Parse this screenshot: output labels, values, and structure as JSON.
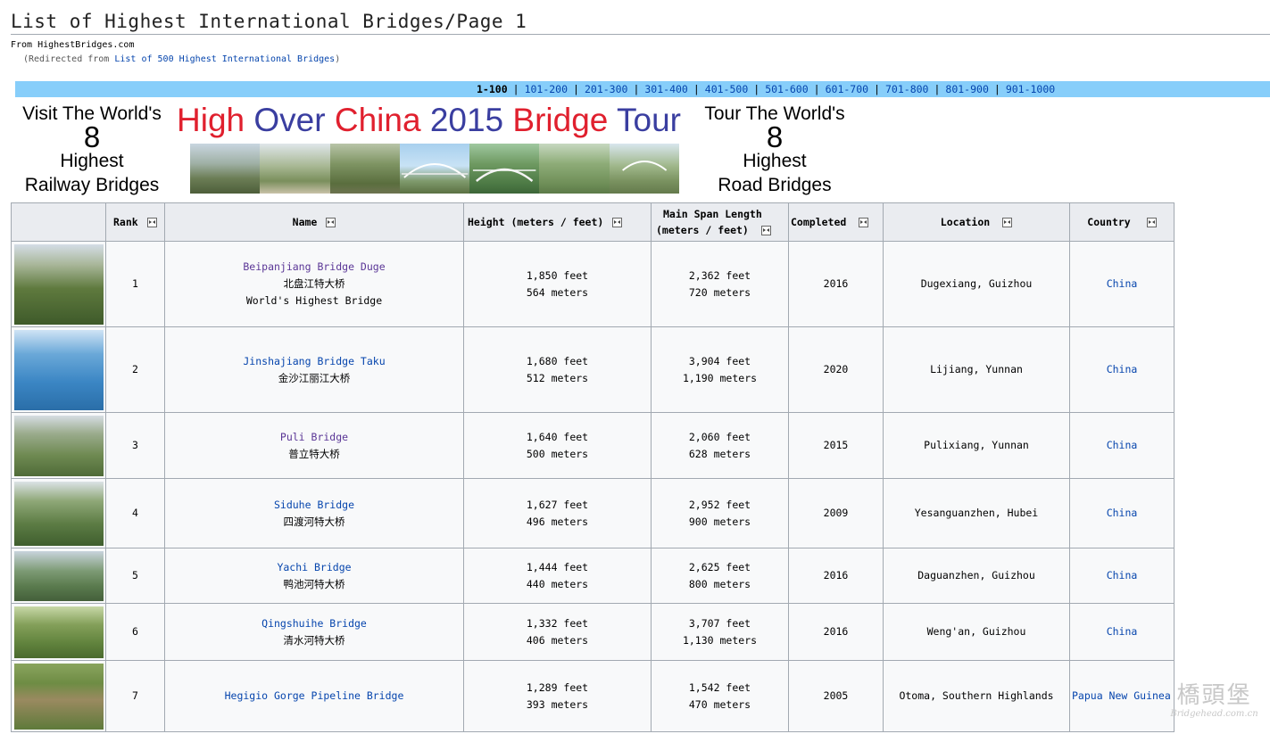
{
  "page": {
    "title": "List of Highest International Bridges/Page 1",
    "site_sub": "From HighestBridges.com",
    "redirect_prefix": "(Redirected from ",
    "redirect_link": "List of 500 Highest International Bridges",
    "redirect_suffix": ")"
  },
  "range_nav": [
    "1-100",
    "101-200",
    "201-300",
    "301-400",
    "401-500",
    "501-600",
    "601-700",
    "701-800",
    "801-900",
    "901-1000"
  ],
  "banner": {
    "left_line1": "Visit The World's",
    "left_num": "8",
    "left_line2": "Highest",
    "left_line3": "Railway Bridges",
    "title_words": [
      {
        "text": "High",
        "color": "#e0202e"
      },
      {
        "text": "Over",
        "color": "#3a3ea0"
      },
      {
        "text": "China",
        "color": "#e0202e"
      },
      {
        "text": "2015",
        "color": "#3a3ea0"
      },
      {
        "text": "Bridge",
        "color": "#e0202e"
      },
      {
        "text": "Tour",
        "color": "#3a3ea0"
      }
    ],
    "right_line1": "Tour The World's",
    "right_num": "8",
    "right_line2": "Highest",
    "right_line3": "Road Bridges"
  },
  "table": {
    "headers": {
      "rank": "Rank",
      "name": "Name",
      "height": "Height (meters / feet)",
      "span_line1": "Main Span Length",
      "span_line2": "(meters / feet)",
      "completed": "Completed",
      "location": "Location",
      "country": "Country"
    },
    "rows": [
      {
        "rank": "1",
        "name": "Beipanjiang Bridge Duge",
        "cn": "北盘江特大桥",
        "note": "World's Highest Bridge",
        "h_ft": "1,850 feet",
        "h_m": "564 meters",
        "s_ft": "2,362 feet",
        "s_m": "720 meters",
        "completed": "2016",
        "location": "Dugexiang, Guizhou",
        "country": "China"
      },
      {
        "rank": "2",
        "name": "Jinshajiang Bridge Taku",
        "cn": "金沙江丽江大桥",
        "note": "",
        "h_ft": "1,680 feet",
        "h_m": "512 meters",
        "s_ft": "3,904 feet",
        "s_m": "1,190 meters",
        "completed": "2020",
        "location": "Lijiang, Yunnan",
        "country": "China"
      },
      {
        "rank": "3",
        "name": "Puli Bridge",
        "cn": "普立特大桥",
        "note": "",
        "h_ft": "1,640 feet",
        "h_m": "500 meters",
        "s_ft": "2,060 feet",
        "s_m": "628 meters",
        "completed": "2015",
        "location": "Pulixiang, Yunnan",
        "country": "China"
      },
      {
        "rank": "4",
        "name": "Siduhe Bridge",
        "cn": "四渡河特大桥",
        "note": "",
        "h_ft": "1,627 feet",
        "h_m": "496 meters",
        "s_ft": "2,952 feet",
        "s_m": "900 meters",
        "completed": "2009",
        "location": "Yesanguanzhen, Hubei",
        "country": "China"
      },
      {
        "rank": "5",
        "name": "Yachi Bridge",
        "cn": "鸭池河特大桥",
        "note": "",
        "h_ft": "1,444 feet",
        "h_m": "440 meters",
        "s_ft": "2,625 feet",
        "s_m": "800 meters",
        "completed": "2016",
        "location": "Daguanzhen, Guizhou",
        "country": "China"
      },
      {
        "rank": "6",
        "name": "Qingshuihe Bridge",
        "cn": "清水河特大桥",
        "note": "",
        "h_ft": "1,332 feet",
        "h_m": "406 meters",
        "s_ft": "3,707 feet",
        "s_m": "1,130 meters",
        "completed": "2016",
        "location": "Weng'an, Guizhou",
        "country": "China"
      },
      {
        "rank": "7",
        "name": "Hegigio Gorge Pipeline Bridge",
        "cn": "",
        "note": "",
        "h_ft": "1,289 feet",
        "h_m": "393 meters",
        "s_ft": "1,542 feet",
        "s_m": "470 meters",
        "completed": "2005",
        "location": "Otoma, Southern Highlands",
        "country": "Papua New Guinea"
      }
    ]
  },
  "watermark": {
    "cn": "橋頭堡",
    "en": "Bridgehead.com.cn"
  }
}
